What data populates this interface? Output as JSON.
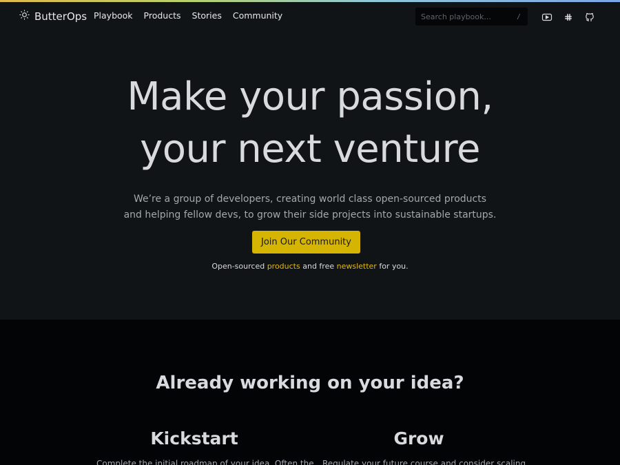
{
  "brand": {
    "name": "ButterOps",
    "icon": "sun-icon"
  },
  "nav": {
    "links": [
      "Playbook",
      "Products",
      "Stories",
      "Community"
    ]
  },
  "search": {
    "placeholder": "Search playbook...",
    "shortcut": "/"
  },
  "social": [
    {
      "icon": "youtube-icon"
    },
    {
      "icon": "slack-icon"
    },
    {
      "icon": "github-icon"
    }
  ],
  "hero": {
    "headline_line1": "Make your passion,",
    "headline_line2": "your next venture",
    "subtext_line1": "We’re a group of developers, creating world class open-sourced products",
    "subtext_line2": "and helping fellow devs, to grow their side projects into sustainable startups.",
    "cta_label": "Join Our Community",
    "note_prefix": "Open-sourced ",
    "note_link1": "products",
    "note_middle": " and free ",
    "note_link2": "newsletter",
    "note_suffix": " for you."
  },
  "ideas": {
    "title": "Already working on your idea?",
    "columns": [
      {
        "title": "Kickstart",
        "text": "Complete the initial roadmap of your idea. Often the"
      },
      {
        "title": "Grow",
        "text": "Regulate your future course and consider scaling"
      }
    ]
  },
  "colors": {
    "accent": "#d6b402",
    "hero_bg": "#111416",
    "page_bg": "#030405"
  }
}
